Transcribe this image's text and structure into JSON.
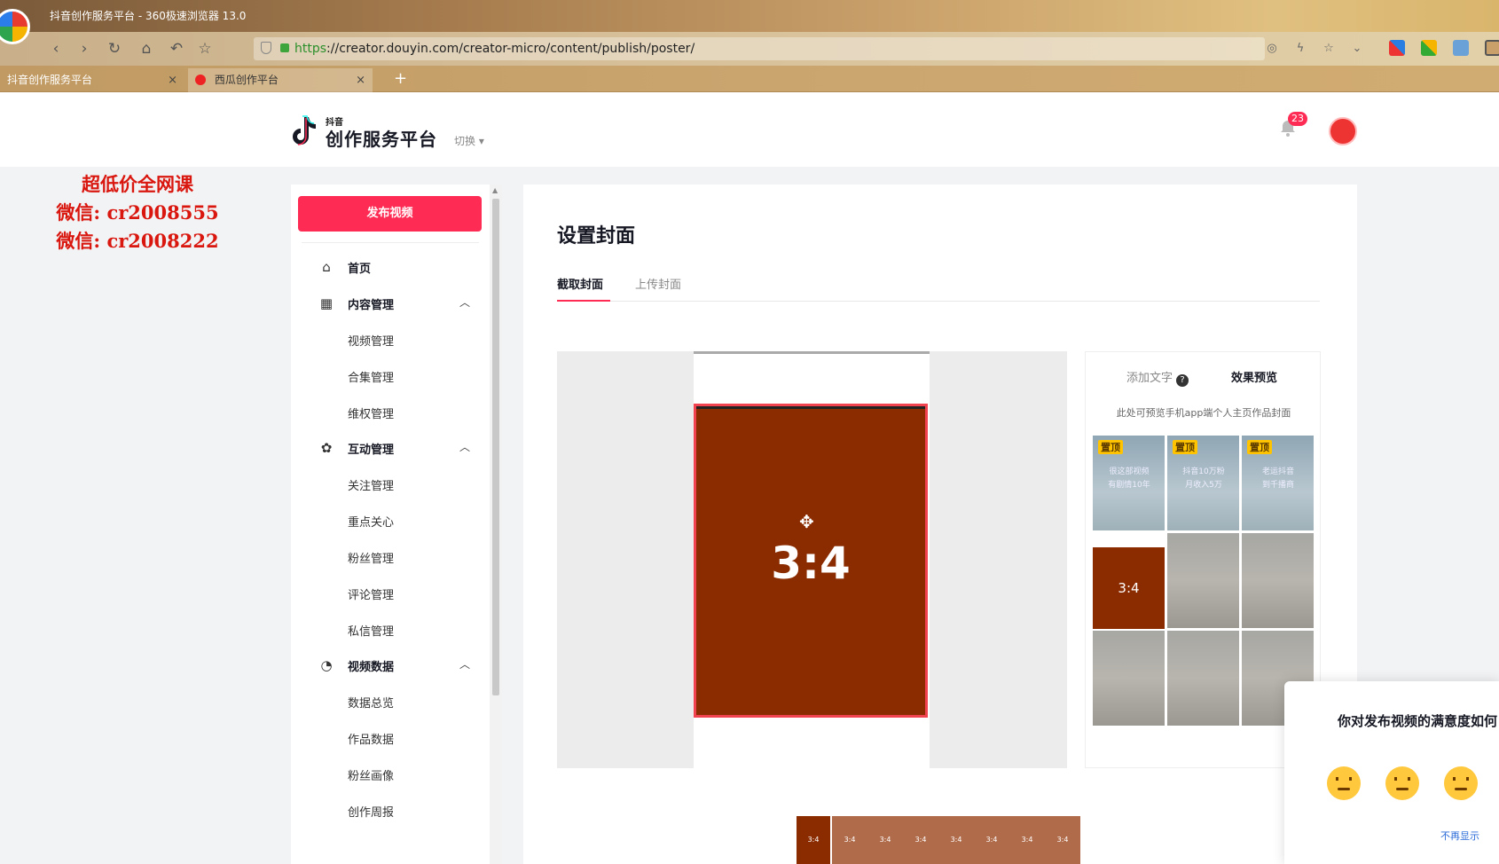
{
  "browser": {
    "window_title": "抖音创作服务平台 - 360极速浏览器 13.0",
    "url_scheme": "https",
    "url_rest": "://creator.douyin.com/creator-micro/content/publish/poster/",
    "tabs": [
      {
        "label": "抖音创作服务平台",
        "close": "×"
      },
      {
        "label": "西瓜创作平台",
        "close": "×"
      }
    ],
    "new_tab": "+"
  },
  "header": {
    "logo_small": "抖音",
    "logo_text": "创作服务平台",
    "switch_label": "切换 ▾",
    "notification_count": "23"
  },
  "promo": {
    "line1": "超低价全网课",
    "line2": "微信: cr2008555",
    "line3": "微信: cr2008222"
  },
  "sidebar": {
    "publish_button": "发布视频",
    "home": "首页",
    "content_mgmt": "内容管理",
    "content_items": [
      "视频管理",
      "合集管理",
      "维权管理"
    ],
    "interact_mgmt": "互动管理",
    "interact_items": [
      "关注管理",
      "重点关心",
      "粉丝管理",
      "评论管理",
      "私信管理"
    ],
    "video_data": "视频数据",
    "data_items": [
      "数据总览",
      "作品数据",
      "粉丝画像",
      "创作周报"
    ]
  },
  "main": {
    "title": "设置封面",
    "tab_capture": "截取封面",
    "tab_upload": "上传封面",
    "crop_ratio": "3:4",
    "preview_add_text": "添加文字",
    "preview_help": "?",
    "preview_title": "效果预览",
    "preview_hint": "此处可预览手机app端个人主页作品封面",
    "pin_label": "置顶",
    "grid_texts": [
      "很这部视频\n有剧情10年",
      "抖音10万粉\n月收入5万",
      "老运抖音\n到千播商"
    ],
    "cover_ratio": "3:4",
    "thumb_label": "3:4"
  },
  "survey": {
    "question": "你对发布视频的满意度如何",
    "dismiss": "不再显示"
  },
  "colors": {
    "accent": "#fe2c55",
    "cover": "#8b2c00"
  }
}
